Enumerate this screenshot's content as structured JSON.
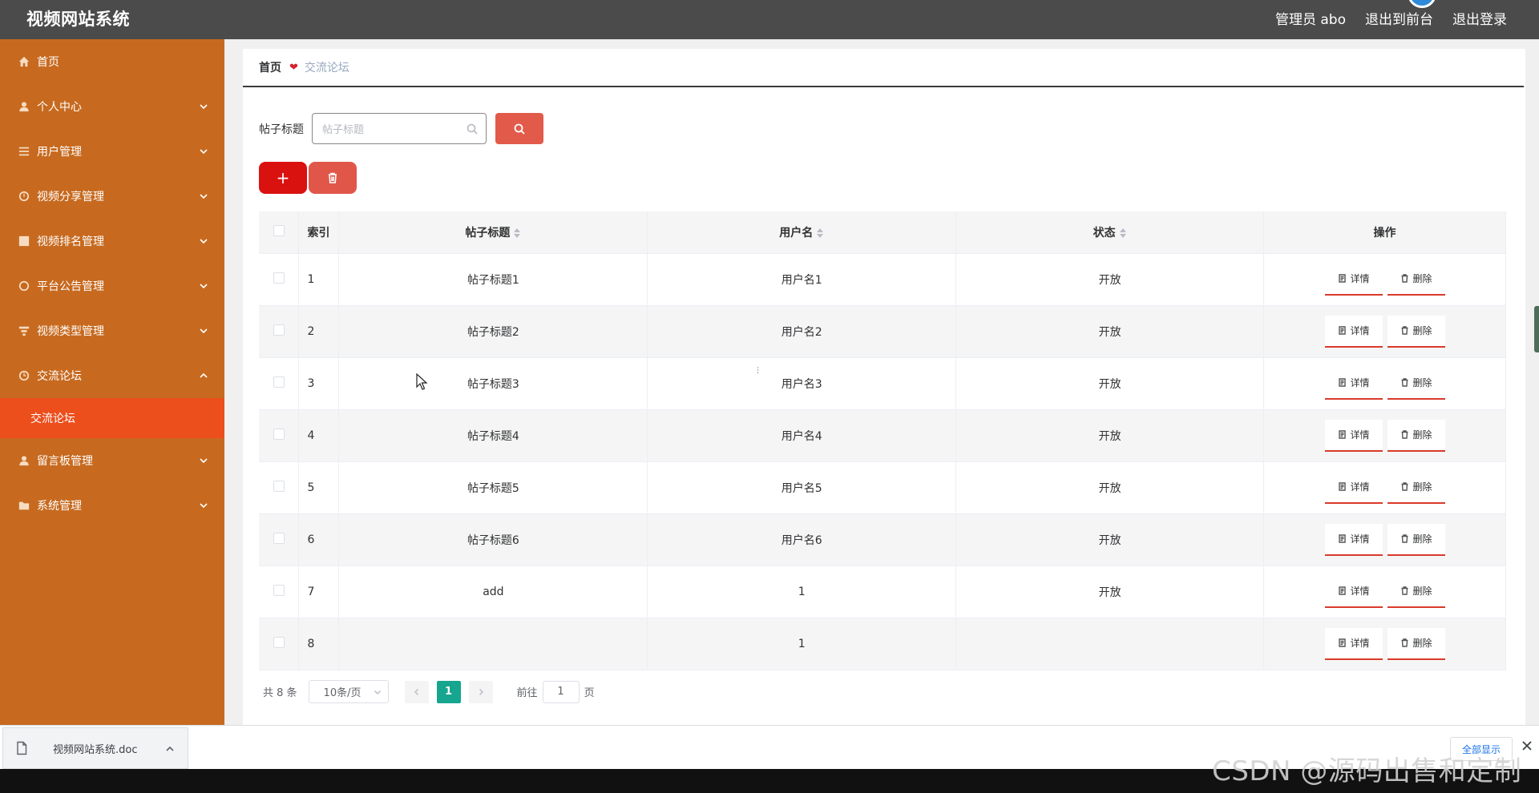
{
  "header": {
    "title": "视频网站系统",
    "user_label": "管理员 abo",
    "front_link": "退出到前台",
    "logout_link": "退出登录"
  },
  "sidebar": {
    "items": [
      {
        "label": "首页",
        "icon": "home-icon"
      },
      {
        "label": "个人中心",
        "icon": "user-icon"
      },
      {
        "label": "用户管理",
        "icon": "list-icon"
      },
      {
        "label": "视频分享管理",
        "icon": "gauge-icon"
      },
      {
        "label": "视频排名管理",
        "icon": "chart-icon"
      },
      {
        "label": "平台公告管理",
        "icon": "clock-icon"
      },
      {
        "label": "视频类型管理",
        "icon": "filter-icon"
      },
      {
        "label": "交流论坛",
        "icon": "clock-icon"
      },
      {
        "label": "留言板管理",
        "icon": "user-icon"
      },
      {
        "label": "系统管理",
        "icon": "folder-icon"
      }
    ],
    "submenu_active": "交流论坛"
  },
  "breadcrumb": {
    "home": "首页",
    "current": "交流论坛",
    "separator_icon": "heart-icon"
  },
  "search": {
    "label": "帖子标题",
    "placeholder": "帖子标题"
  },
  "actions": {
    "add_label": "+"
  },
  "table": {
    "columns": {
      "index": "索引",
      "title": "帖子标题",
      "user": "用户名",
      "status": "状态",
      "ops": "操作"
    },
    "rows": [
      {
        "idx": "1",
        "title": "帖子标题1",
        "user": "用户名1",
        "status": "开放"
      },
      {
        "idx": "2",
        "title": "帖子标题2",
        "user": "用户名2",
        "status": "开放"
      },
      {
        "idx": "3",
        "title": "帖子标题3",
        "user": "用户名3",
        "status": "开放"
      },
      {
        "idx": "4",
        "title": "帖子标题4",
        "user": "用户名4",
        "status": "开放"
      },
      {
        "idx": "5",
        "title": "帖子标题5",
        "user": "用户名5",
        "status": "开放"
      },
      {
        "idx": "6",
        "title": "帖子标题6",
        "user": "用户名6",
        "status": "开放"
      },
      {
        "idx": "7",
        "title": "add",
        "user": "1",
        "status": "开放"
      },
      {
        "idx": "8",
        "title": "",
        "user": "1",
        "status": ""
      }
    ],
    "detail_label": "详情",
    "delete_label": "删除"
  },
  "pagination": {
    "total": "共 8 条",
    "page_size": "10条/页",
    "current_page": "1",
    "goto_label": "前往",
    "goto_value": "1",
    "page_suffix": "页"
  },
  "downloads": {
    "file_name": "视频网站系统.doc",
    "show_all": "全部显示"
  },
  "watermark": "CSDN @源码出售和定制",
  "colors": {
    "topbar": "#4b4b4b",
    "sidebar": "#c76a1f",
    "sidebar_active": "#ec4e1c",
    "search_button": "#e25a4a",
    "add_button": "#d9110f",
    "page_active": "#16a58e"
  }
}
